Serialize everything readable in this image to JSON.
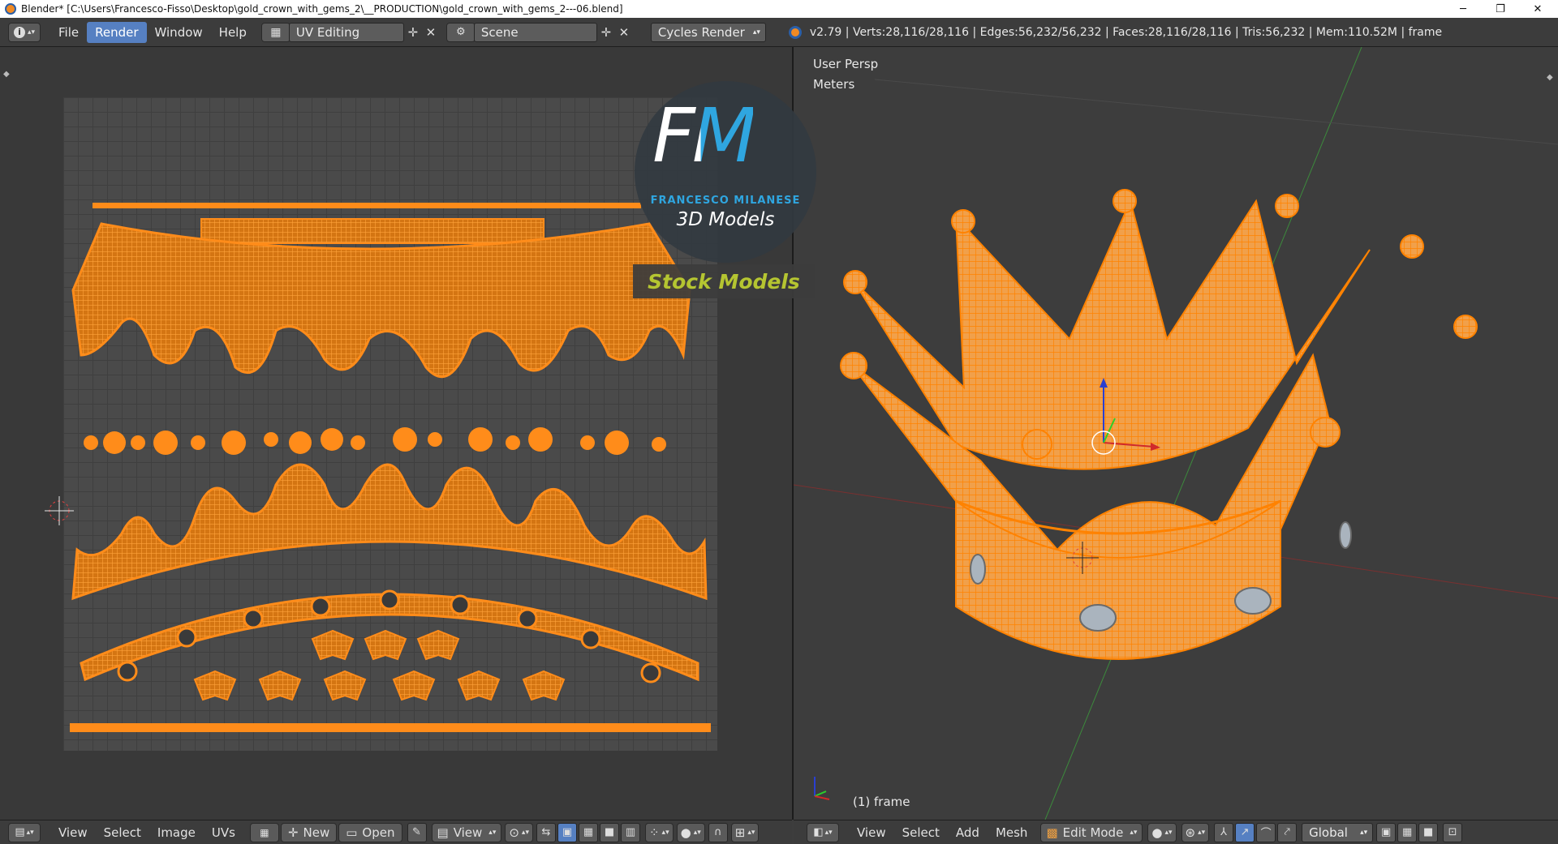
{
  "window": {
    "title": "Blender* [C:\\Users\\Francesco-Fisso\\Desktop\\gold_crown_with_gems_2\\__PRODUCTION\\gold_crown_with_gems_2---06.blend]",
    "minimize": "─",
    "maximize": "❐",
    "close": "✕"
  },
  "topbar": {
    "menus": [
      "File",
      "Render",
      "Window",
      "Help"
    ],
    "active_menu": "Render",
    "layout_name": "UV Editing",
    "scene_name": "Scene",
    "render_engine": "Cycles Render",
    "stats": "v2.79 | Verts:28,116/28,116 | Edges:56,232/56,232 | Faces:28,116/28,116 | Tris:56,232 | Mem:110.52M | frame"
  },
  "viewport": {
    "view_name": "User Persp",
    "units": "Meters",
    "frame_label": "(1) frame"
  },
  "watermark": {
    "logo_letters": "FM",
    "brand": "FRANCESCO MILANESE",
    "subtitle": "3D Models",
    "banner": "Stock Models"
  },
  "uv_header": {
    "menus": [
      "View",
      "Select",
      "Image",
      "UVs"
    ],
    "new_label": "New",
    "open_label": "Open",
    "view_label": "View"
  },
  "view3d_header": {
    "menus": [
      "View",
      "Select",
      "Add",
      "Mesh"
    ],
    "mode": "Edit Mode",
    "orientation": "Global"
  },
  "colors": {
    "accent": "#5680c2",
    "mesh": "#ff8c1a",
    "background": "#3d3d3d"
  }
}
